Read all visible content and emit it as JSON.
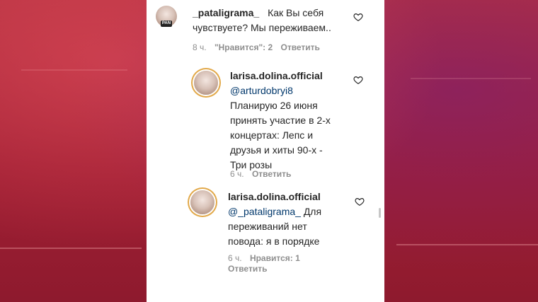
{
  "comments": [
    {
      "username": "_pataligrama_",
      "text_line1": "Как Вы себя",
      "text_line2": "чувствуете? Мы переживаем..",
      "avatar_badge": "PAN",
      "time": "8 ч.",
      "likes": "\"Нравится\": 2",
      "reply_label": "Ответить"
    },
    {
      "username": "larisa.dolina.official",
      "mention": "@arturdobryi8",
      "lines": [
        "Планирую 26 июня",
        "принять участие в 2-х",
        "концертах: Лепс и",
        "друзья и хиты 90-х -",
        "Три розы"
      ],
      "time": "6 ч.",
      "reply_label": "Ответить"
    },
    {
      "username": "larisa.dolina.official",
      "mention": "@_pataligrama_",
      "mention_suffix": "Для",
      "lines": [
        "переживаний нет",
        "повода: я в порядке"
      ],
      "time": "6 ч.",
      "likes": "Нравится: 1",
      "reply_label": "Ответить"
    }
  ]
}
